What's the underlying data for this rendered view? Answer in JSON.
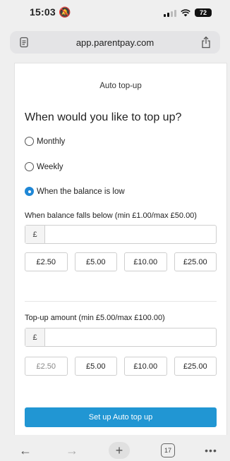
{
  "status_bar": {
    "time": "15:03",
    "battery": "72"
  },
  "browser": {
    "url": "app.parentpay.com"
  },
  "page": {
    "title": "Auto top-up",
    "question": "When would you like to top up?",
    "frequency_options": [
      {
        "label": "Monthly",
        "selected": false
      },
      {
        "label": "Weekly",
        "selected": false
      },
      {
        "label": "When the balance is low",
        "selected": true
      }
    ],
    "threshold": {
      "label": "When balance falls below (min £1.00/max £50.00)",
      "prefix": "£",
      "value": "",
      "presets": [
        "£2.50",
        "£5.00",
        "£10.00",
        "£25.00"
      ]
    },
    "topup": {
      "label": "Top-up amount (min £5.00/max £100.00)",
      "prefix": "£",
      "value": "",
      "presets": [
        "£2.50",
        "£5.00",
        "£10.00",
        "£25.00"
      ]
    },
    "submit_label": "Set up Auto top up"
  },
  "toolbar": {
    "back": "←",
    "forward": "→",
    "new_tab": "+",
    "tab_count": "17",
    "more": "•••"
  },
  "colors": {
    "accent": "#2196d3",
    "radio_selected": "#1f87d6"
  }
}
